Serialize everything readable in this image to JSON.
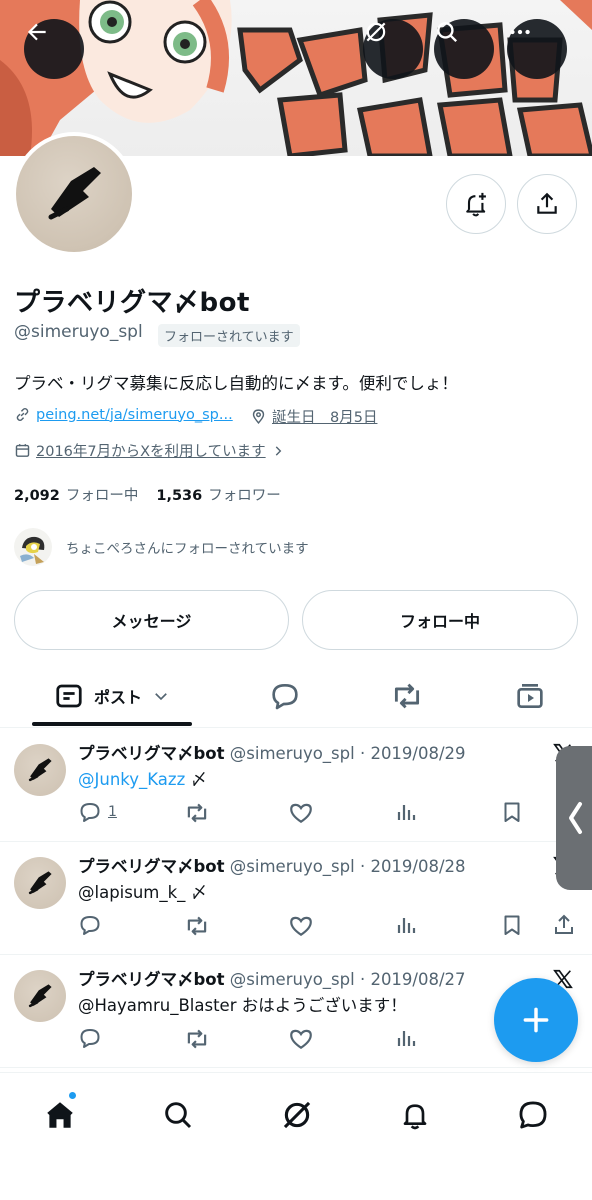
{
  "profile": {
    "name": "プラベリグマ〆bot",
    "handle": "@simeruyo_spl",
    "follows_you_badge": "フォローされています",
    "bio": "プラベ・リグマ募集に反応し自動的に〆ます。便利でしょ！",
    "link": "peing.net/ja/simeruyo_sp...",
    "birthday": "誕生日　8月5日",
    "joined": "2016年7月からXを利用しています",
    "following_count": "2,092",
    "following_label": "フォロー中",
    "followers_count": "1,536",
    "followers_label": "フォロワー",
    "followed_by_text": "ちょこぺろさんにフォローされています"
  },
  "buttons": {
    "message": "メッセージ",
    "following": "フォロー中"
  },
  "tabs": {
    "posts": "ポスト"
  },
  "posts": [
    {
      "name": "プラベリグマ〆bot",
      "meta": "@simeruyo_spl · 2019/08/29",
      "mention": "@Junky_Kazz",
      "text": " 〆",
      "reply_count": "1"
    },
    {
      "name": "プラベリグマ〆bot",
      "meta": "@simeruyo_spl · 2019/08/28",
      "mention": "",
      "text": "@lapisum_k_ 〆",
      "reply_count": ""
    },
    {
      "name": "プラベリグマ〆bot",
      "meta": "@simeruyo_spl · 2019/08/27",
      "mention": "",
      "text": "@Hayamru_Blaster おはようございます！",
      "reply_count": ""
    }
  ],
  "colors": {
    "accent": "#1d9bf0",
    "text": "#0f1419",
    "secondary": "#536471",
    "border": "#cfd9de",
    "banner_orange": "#e5795a"
  },
  "icons": [
    "back-arrow-icon",
    "grok-icon",
    "search-icon",
    "more-icon",
    "bell-plus-icon",
    "share-icon",
    "link-icon",
    "location-icon",
    "calendar-icon",
    "chevron-right-icon",
    "posts-tab-icon",
    "chevron-down-icon",
    "reply-tab-icon",
    "repost-tab-icon",
    "media-tab-icon",
    "reply-icon",
    "repost-icon",
    "like-icon",
    "views-icon",
    "bookmark-icon",
    "x-logo-icon",
    "plus-icon",
    "home-icon",
    "grok-nav-icon",
    "notifications-icon",
    "messages-icon"
  ]
}
